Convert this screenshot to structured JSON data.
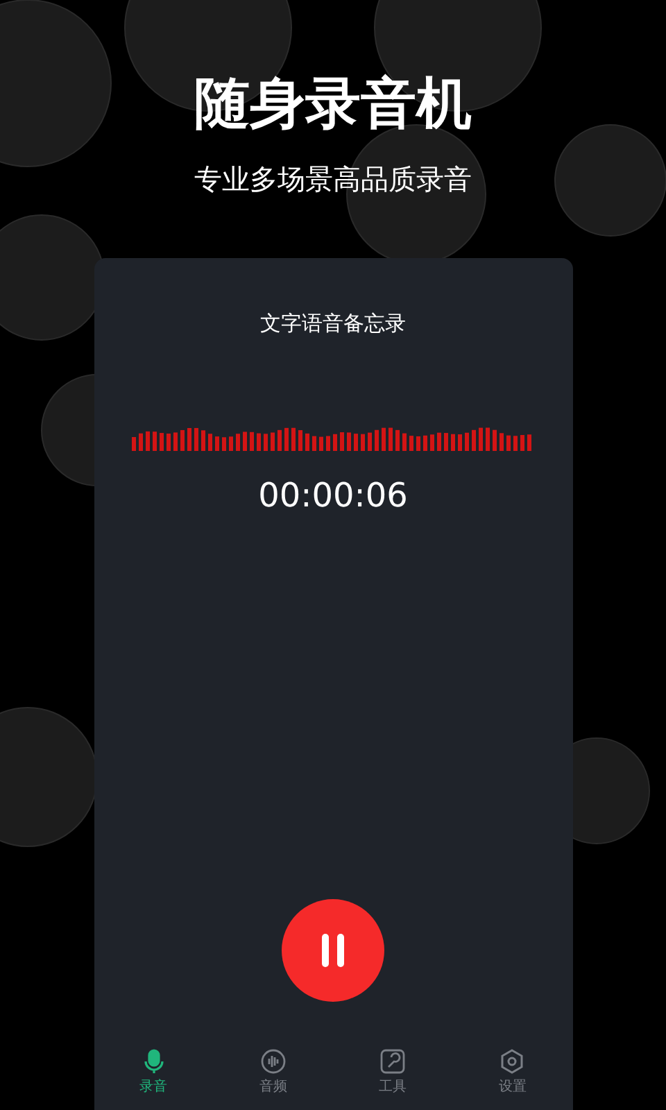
{
  "headline": "随身录音机",
  "subtitle": "专业多场景高品质录音",
  "card": {
    "title": "文字语音备忘录",
    "timer": "00:00:06",
    "recording": true
  },
  "tabs": [
    {
      "label": "录音",
      "kind": "mic",
      "selected": true
    },
    {
      "label": "音频",
      "kind": "audio",
      "selected": false
    },
    {
      "label": "工具",
      "kind": "tools",
      "selected": false
    },
    {
      "label": "设置",
      "kind": "settings",
      "selected": false
    }
  ]
}
